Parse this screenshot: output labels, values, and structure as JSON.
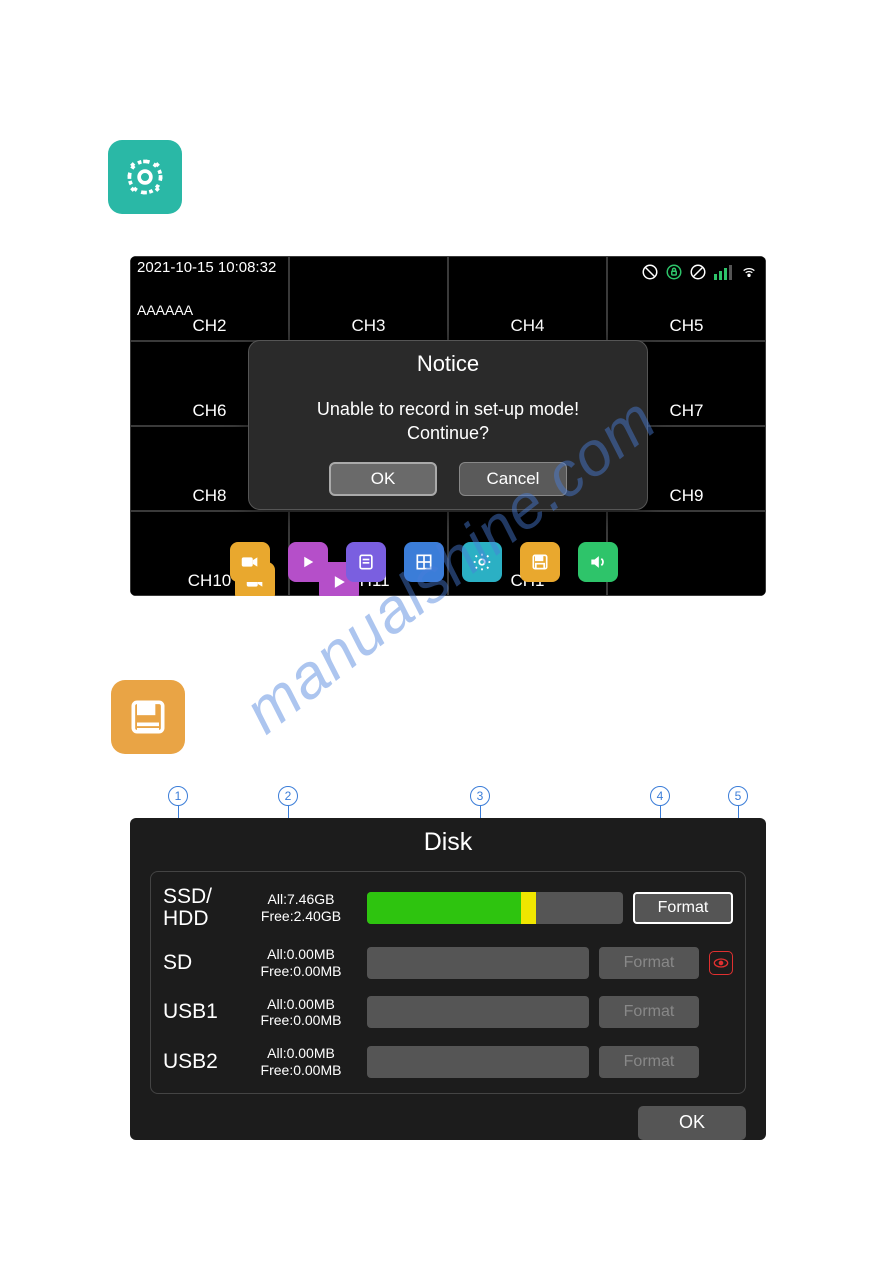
{
  "icons": {
    "settings_block": "gear-icon",
    "save_block": "save-icon"
  },
  "screen1": {
    "timestamp": "2021-10-15 10:08:32",
    "channel_name_row1": "AAAAAA",
    "channels": [
      "CH2",
      "CH3",
      "CH4",
      "CH5",
      "CH6",
      "CH7",
      "CH8",
      "CH9",
      "CH10",
      "CH11",
      "CH1"
    ],
    "status_icons": [
      "prohibit-icon",
      "lock-icon",
      "no-sync-icon",
      "signal-icon",
      "wifi-icon"
    ],
    "notice": {
      "title": "Notice",
      "message_line1": "Unable to record in set-up mode!",
      "message_line2": "Continue?",
      "ok_label": "OK",
      "cancel_label": "Cancel"
    },
    "toolbar": [
      "camera-icon",
      "play-icon",
      "note-icon",
      "grid-icon",
      "gear-icon",
      "save-icon",
      "sound-icon"
    ]
  },
  "callouts": [
    "1",
    "2",
    "3",
    "4",
    "5"
  ],
  "disk": {
    "title": "Disk",
    "rows": [
      {
        "name": "SSD/\nHDD",
        "all": "All:7.46GB",
        "free": "Free:2.40GB",
        "used_pct": 60,
        "warn_pct": 6,
        "format_label": "Format",
        "active": true,
        "warn_badge": false
      },
      {
        "name": "SD",
        "all": "All:0.00MB",
        "free": "Free:0.00MB",
        "used_pct": 0,
        "warn_pct": 0,
        "format_label": "Format",
        "active": false,
        "warn_badge": true
      },
      {
        "name": "USB1",
        "all": "All:0.00MB",
        "free": "Free:0.00MB",
        "used_pct": 0,
        "warn_pct": 0,
        "format_label": "Format",
        "active": false,
        "warn_badge": false
      },
      {
        "name": "USB2",
        "all": "All:0.00MB",
        "free": "Free:0.00MB",
        "used_pct": 0,
        "warn_pct": 0,
        "format_label": "Format",
        "active": false,
        "warn_badge": false
      }
    ],
    "ok_label": "OK"
  },
  "watermark": "manualshine.com"
}
